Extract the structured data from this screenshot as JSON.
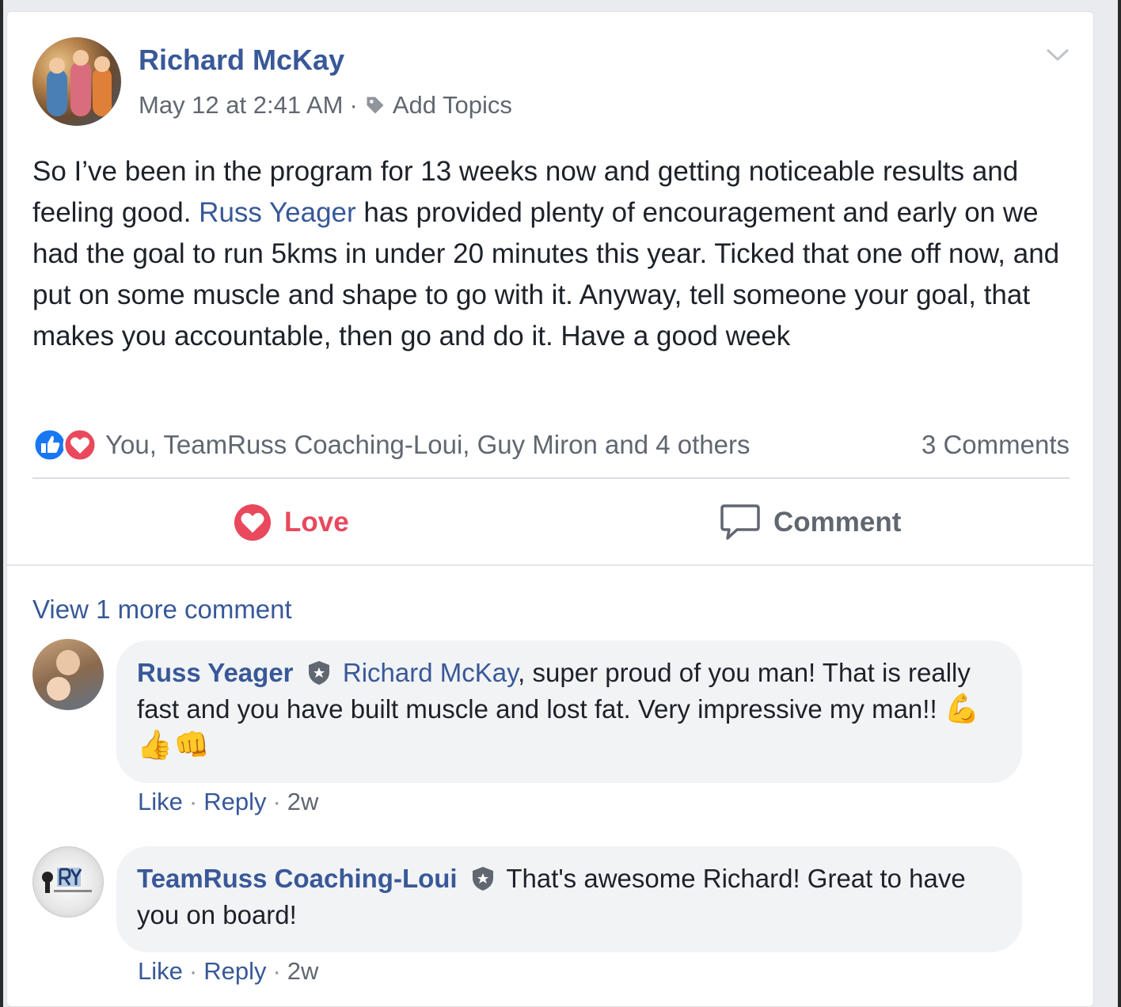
{
  "post": {
    "author": "Richard McKay",
    "timestamp": "May 12 at 2:41 AM",
    "separator": "·",
    "add_topics": "Add Topics",
    "text_before_mention": "So I’ve been in the program for 13 weeks now and getting noticeable results and feeling good. ",
    "mention": "Russ Yeager",
    "text_after_mention": " has provided plenty of encouragement and early on we had the goal to run 5kms in under 20 minutes this year. Ticked that one off now, and put on some muscle and shape to go with it. Anyway, tell someone your goal, that makes you accountable, then go and do it. Have a good week"
  },
  "reactions": {
    "icons": [
      "like-icon",
      "love-icon"
    ],
    "summary": "You, TeamRuss Coaching-Loui, Guy Miron and 4 others",
    "comments_count": "3 Comments"
  },
  "actions": {
    "love_label": "Love",
    "comment_label": "Comment"
  },
  "comments": {
    "view_more": "View 1 more comment",
    "items": [
      {
        "author": "Russ Yeager",
        "mention": "Richard McKay",
        "text": ", super proud of you man! That is really fast and you have built muscle and lost fat. Very impressive my man!! ",
        "emoji": "💪👍👊",
        "like": "Like",
        "reply": "Reply",
        "time": "2w"
      },
      {
        "author": "TeamRuss Coaching-Loui",
        "text": " That's awesome Richard! Great to have you on board!",
        "like": "Like",
        "reply": "Reply",
        "time": "2w"
      }
    ]
  },
  "colors": {
    "link": "#385898",
    "love": "#e9485d",
    "like": "#1877f2",
    "muted": "#606770"
  }
}
